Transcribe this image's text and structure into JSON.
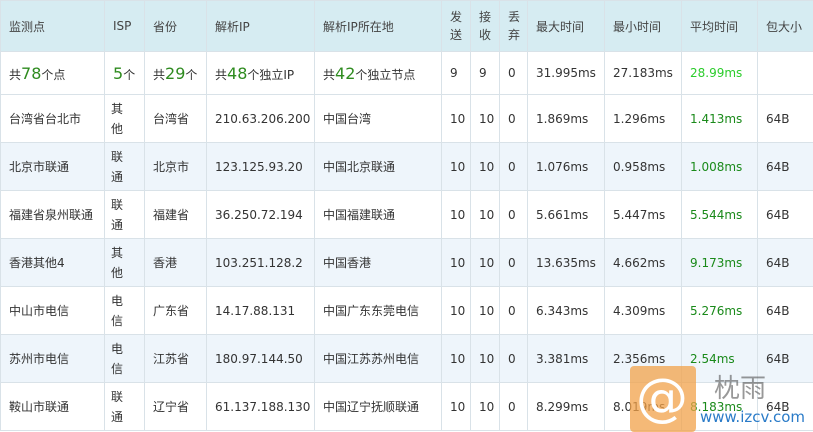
{
  "headers": {
    "node": "监测点",
    "isp": "ISP",
    "province": "省份",
    "ip": "解析IP",
    "location": "解析IP所在地",
    "sent_1": "发",
    "sent_2": "送",
    "recv_1": "接",
    "recv_2": "收",
    "lost_1": "丢",
    "lost_2": "弃",
    "max": "最大时间",
    "min": "最小时间",
    "avg": "平均时间",
    "size": "包大小"
  },
  "summary": {
    "nodes_pre": "共",
    "nodes_num": "78",
    "nodes_post": "个点",
    "isp_num": "5",
    "isp_post": "个",
    "prov_pre": "共",
    "prov_num": "29",
    "prov_post": "个",
    "ip_pre": "共",
    "ip_num": "48",
    "ip_post": "个独立IP",
    "loc_pre": "共",
    "loc_num": "42",
    "loc_post": "个独立节点",
    "sent": "9",
    "recv": "9",
    "lost": "0",
    "max": "31.995ms",
    "min": "27.183ms",
    "avg": "28.99ms",
    "size": ""
  },
  "rows": [
    {
      "node": "台湾省台北市",
      "isp1": "其",
      "isp2": "他",
      "province": "台湾省",
      "ip": "210.63.206.200",
      "location": "中国台湾",
      "sent": "10",
      "recv": "10",
      "lost": "0",
      "max": "1.869ms",
      "min": "1.296ms",
      "avg": "1.413ms",
      "size": "64B"
    },
    {
      "node": "北京市联通",
      "isp1": "联",
      "isp2": "通",
      "province": "北京市",
      "ip": "123.125.93.20",
      "location": "中国北京联通",
      "sent": "10",
      "recv": "10",
      "lost": "0",
      "max": "1.076ms",
      "min": "0.958ms",
      "avg": "1.008ms",
      "size": "64B"
    },
    {
      "node": "福建省泉州联通",
      "isp1": "联",
      "isp2": "通",
      "province": "福建省",
      "ip": "36.250.72.194",
      "location": "中国福建联通",
      "sent": "10",
      "recv": "10",
      "lost": "0",
      "max": "5.661ms",
      "min": "5.447ms",
      "avg": "5.544ms",
      "size": "64B"
    },
    {
      "node": "香港其他4",
      "isp1": "其",
      "isp2": "他",
      "province": "香港",
      "ip": "103.251.128.2",
      "location": "中国香港",
      "sent": "10",
      "recv": "10",
      "lost": "0",
      "max": "13.635ms",
      "min": "4.662ms",
      "avg": "9.173ms",
      "size": "64B"
    },
    {
      "node": "中山市电信",
      "isp1": "电",
      "isp2": "信",
      "province": "广东省",
      "ip": "14.17.88.131",
      "location": "中国广东东莞电信",
      "sent": "10",
      "recv": "10",
      "lost": "0",
      "max": "6.343ms",
      "min": "4.309ms",
      "avg": "5.276ms",
      "size": "64B"
    },
    {
      "node": "苏州市电信",
      "isp1": "电",
      "isp2": "信",
      "province": "江苏省",
      "ip": "180.97.144.50",
      "location": "中国江苏苏州电信",
      "sent": "10",
      "recv": "10",
      "lost": "0",
      "max": "3.381ms",
      "min": "2.356ms",
      "avg": "2.54ms",
      "size": "64B"
    },
    {
      "node": "鞍山市联通",
      "isp1": "联",
      "isp2": "通",
      "province": "辽宁省",
      "ip": "61.137.188.130",
      "location": "中国辽宁抚顺联通",
      "sent": "10",
      "recv": "10",
      "lost": "0",
      "max": "8.299ms",
      "min": "8.019ms",
      "avg": "8.183ms",
      "size": "64B"
    }
  ],
  "watermark": {
    "symbol": "@",
    "site": "www.izcv.com",
    "signature": "枕雨"
  }
}
